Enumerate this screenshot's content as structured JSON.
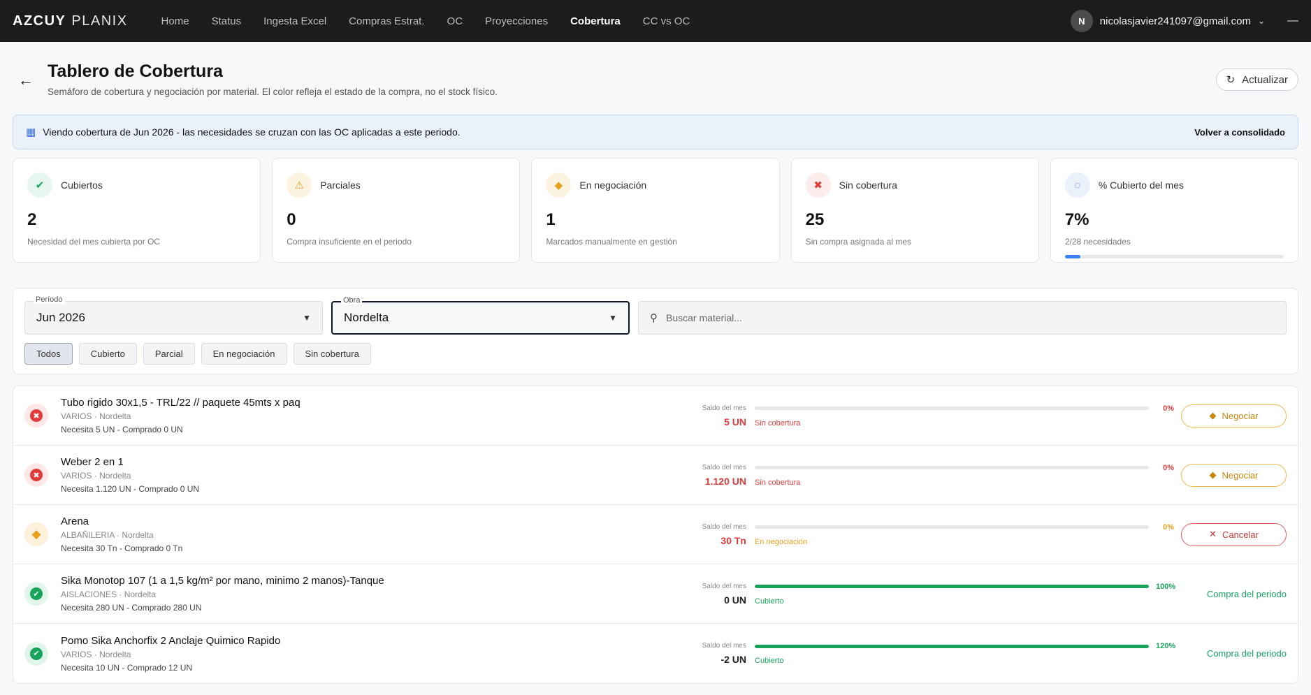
{
  "brand": {
    "bold": "AZCUY",
    "light": "PLANIX"
  },
  "nav": [
    "Home",
    "Status",
    "Ingesta Excel",
    "Compras Estrat.",
    "OC",
    "Proyecciones",
    "Cobertura",
    "CC vs OC"
  ],
  "user": {
    "initial": "N",
    "email": "nicolasjavier241097@gmail.com"
  },
  "header": {
    "title": "Tablero de Cobertura",
    "subtitle": "Semáforo de cobertura y negociación por material. El color refleja el estado de la compra, no el stock físico.",
    "refresh_label": "Actualizar"
  },
  "banner": {
    "text": "Viendo cobertura de Jun 2026 - las necesidades se cruzan con las OC aplicadas a este periodo.",
    "action": "Volver a consolidado"
  },
  "stats": [
    {
      "label": "Cubiertos",
      "value": "2",
      "desc": "Necesidad del mes cubierta por OC"
    },
    {
      "label": "Parciales",
      "value": "0",
      "desc": "Compra insuficiente en el periodo"
    },
    {
      "label": "En negociación",
      "value": "1",
      "desc": "Marcados manualmente en gestión"
    },
    {
      "label": "Sin cobertura",
      "value": "25",
      "desc": "Sin compra asignada al mes"
    },
    {
      "label": "% Cubierto del mes",
      "value": "7%",
      "desc": "2/28 necesidades",
      "progress": 0.07
    }
  ],
  "filters": {
    "periodo_label": "Período",
    "periodo_value": "Jun 2026",
    "obra_label": "Obra",
    "obra_value": "Nordelta",
    "search_placeholder": "Buscar material...",
    "chips": [
      "Todos",
      "Cubierto",
      "Parcial",
      "En negociación",
      "Sin cobertura"
    ]
  },
  "saldo_label": "Saldo del mes",
  "items": [
    {
      "name": "Tubo rigido 30x1,5 - TRL/22 // paquete 45mts x paq",
      "category": "VARIOS · Nordelta",
      "need": "Necesita 5 UN - Comprado 0 UN",
      "saldo": "5 UN",
      "status": "Sin cobertura",
      "pct": "0%",
      "fill": 0,
      "action": "Negociar"
    },
    {
      "name": "Weber 2 en 1",
      "category": "VARIOS · Nordelta",
      "need": "Necesita 1.120 UN - Comprado 0 UN",
      "saldo": "1.120 UN",
      "status": "Sin cobertura",
      "pct": "0%",
      "fill": 0,
      "action": "Negociar"
    },
    {
      "name": "Arena",
      "category": "ALBAÑILERIA · Nordelta",
      "need": "Necesita 30 Tn - Comprado 0 Tn",
      "saldo": "30 Tn",
      "status": "En negociación",
      "pct": "0%",
      "fill": 0,
      "action": "Cancelar"
    },
    {
      "name": "Sika Monotop 107 (1 a 1,5 kg/m² por mano,  minimo 2 manos)-Tanque",
      "category": "AISLACIONES · Nordelta",
      "need": "Necesita 280 UN - Comprado 280 UN",
      "saldo": "0 UN",
      "status": "Cubierto",
      "pct": "100%",
      "fill": 1,
      "action": "Compra del periodo"
    },
    {
      "name": "Pomo Sika Anchorfix 2 Anclaje Quimico Rapido",
      "category": "VARIOS · Nordelta",
      "need": "Necesita 10 UN - Comprado 12 UN",
      "saldo": "-2 UN",
      "status": "Cubierto",
      "pct": "120%",
      "fill": 1,
      "action": "Compra del periodo"
    }
  ],
  "colors": {
    "red": "#e23b3b",
    "amber": "#e8a020",
    "green": "#17a35a",
    "blue": "#3b82f6"
  }
}
